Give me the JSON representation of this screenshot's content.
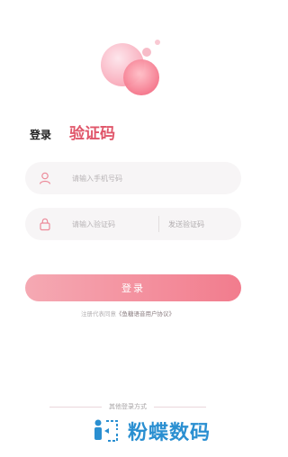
{
  "tabs": {
    "login": "登录",
    "verification_code": "验证码"
  },
  "phone_field": {
    "placeholder": "请输入手机号码"
  },
  "code_field": {
    "placeholder": "请输入验证码",
    "send_code": "发送验证码"
  },
  "login_button": "登录",
  "agreement": {
    "prefix": "注册代表同意",
    "link": "《鱼糖语音用户协议》"
  },
  "other_login": "其他登录方式",
  "watermark": {
    "text": "粉蝶数码",
    "color": "#2a8fd1"
  },
  "accent_color": "#e0566a"
}
